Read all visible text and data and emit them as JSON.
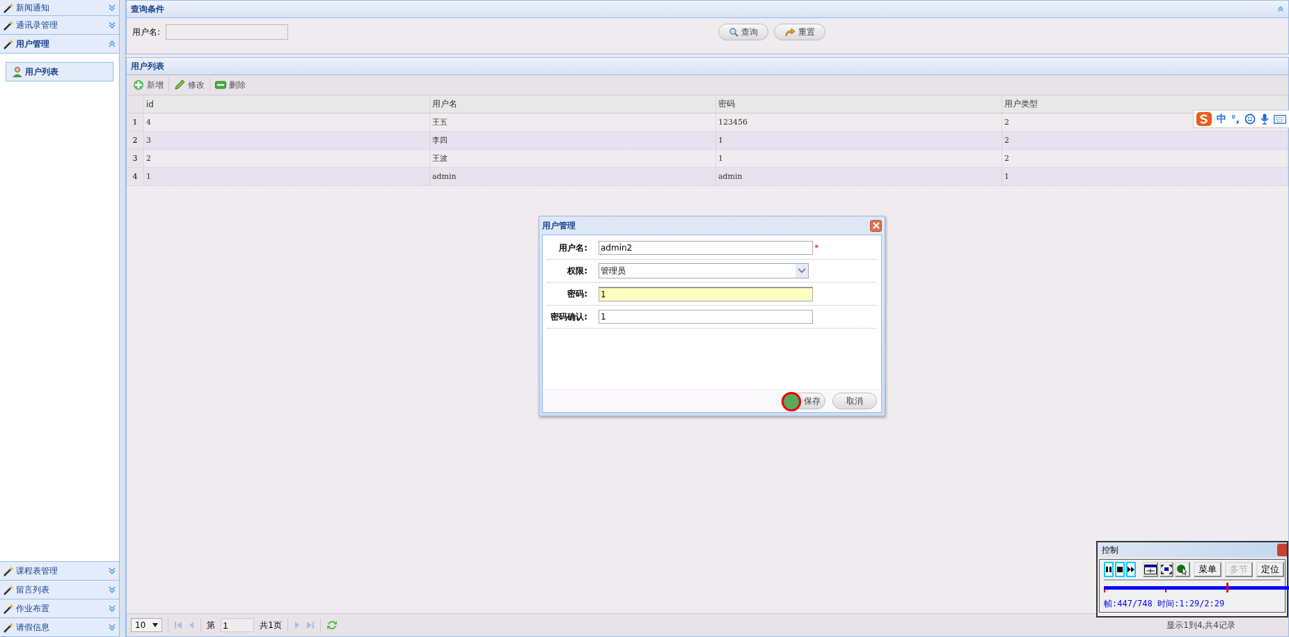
{
  "sidebar": {
    "sections": [
      {
        "label": "新闻通知",
        "expanded": false
      },
      {
        "label": "通讯录管理",
        "expanded": false
      },
      {
        "label": "用户管理",
        "expanded": true,
        "children": [
          {
            "label": "用户列表",
            "selected": true
          }
        ]
      },
      {
        "label": "课程表管理",
        "expanded": false
      },
      {
        "label": "留言列表",
        "expanded": false
      },
      {
        "label": "作业布置",
        "expanded": false
      },
      {
        "label": "请假信息",
        "expanded": false
      }
    ]
  },
  "query_panel": {
    "title": "查询条件",
    "field_label": "用户名:",
    "buttons": [
      {
        "label": "查询",
        "kind": "search"
      },
      {
        "label": "重置",
        "kind": "reset"
      }
    ]
  },
  "list_panel": {
    "title": "用户列表",
    "toolbar": [
      {
        "label": "新增",
        "kind": "add"
      },
      {
        "label": "修改",
        "kind": "edit"
      },
      {
        "label": "删除",
        "kind": "delete"
      }
    ],
    "columns": [
      "id",
      "用户名",
      "密码",
      "用户类型"
    ],
    "rows": [
      {
        "number": "1",
        "cells": [
          "4",
          "王五",
          "123456",
          "2"
        ]
      },
      {
        "number": "2",
        "cells": [
          "3",
          "李四",
          "1",
          "2"
        ]
      },
      {
        "number": "3",
        "cells": [
          "2",
          "王波",
          "1",
          "2"
        ]
      },
      {
        "number": "4",
        "cells": [
          "1",
          "admin",
          "admin",
          "1"
        ]
      }
    ],
    "pager": {
      "page_size": "10",
      "page_prefix": "第",
      "page": "1",
      "page_total": "共1页",
      "summary": "显示1到4,共4记录"
    }
  },
  "ime_bar": {
    "items": [
      {
        "kind": "logo"
      },
      {
        "kind": "text",
        "label": "中"
      },
      {
        "kind": "text",
        "label": "°,"
      },
      {
        "kind": "smiley"
      },
      {
        "kind": "mic"
      },
      {
        "kind": "keyboard"
      }
    ]
  },
  "dialog": {
    "title": "用户管理",
    "required_mark": "*",
    "fields": [
      {
        "label": "用户名:",
        "value": "admin2",
        "kind": "text",
        "required": true,
        "focused": false
      },
      {
        "label": "权限:",
        "value": "管理员",
        "kind": "select",
        "required": false,
        "focused": false
      },
      {
        "label": "密码:",
        "value": "1",
        "kind": "text",
        "required": false,
        "focused": true
      },
      {
        "label": "密码确认:",
        "value": "1",
        "kind": "text",
        "required": false,
        "focused": false
      }
    ],
    "buttons": [
      {
        "label": "保存",
        "clicked": true
      },
      {
        "label": "取消",
        "clicked": false
      }
    ]
  },
  "player_control": {
    "title": "控制",
    "buttons": [
      {
        "kind": "pause"
      },
      {
        "kind": "stop"
      },
      {
        "kind": "step"
      },
      {
        "kind": "fit"
      },
      {
        "kind": "full"
      },
      {
        "kind": "cursor"
      },
      {
        "kind": "text",
        "label": "菜单",
        "disabled": false
      },
      {
        "kind": "text",
        "label": "多节",
        "disabled": true
      },
      {
        "kind": "text",
        "label": "定位",
        "disabled": false
      }
    ],
    "level": 0.6,
    "status": "帧:447/748 时间:1:29/2:29"
  }
}
